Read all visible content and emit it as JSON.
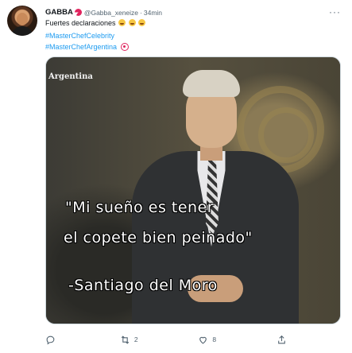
{
  "tweet": {
    "display_name": "GABBA",
    "handle": "@Gabba_xeneize",
    "separator": "·",
    "time": "34min",
    "text": "Fuertes declaraciones",
    "hashtags": [
      "#MasterChefCelebrity",
      "#MasterChefArgentina"
    ],
    "more_label": "···"
  },
  "media": {
    "watermark": "Argentina",
    "caption_lines": [
      "\"Mi sueño es tener",
      "el copete bien peinado\"",
      "-Santiago del Moro"
    ]
  },
  "actions": {
    "reply_count": "",
    "retweet_count": "2",
    "like_count": "8",
    "icons": [
      "reply-icon",
      "retweet-icon",
      "like-icon",
      "share-icon"
    ]
  },
  "colors": {
    "link": "#1d9bf0",
    "secondary": "#536471",
    "brand": "#e0245e"
  }
}
